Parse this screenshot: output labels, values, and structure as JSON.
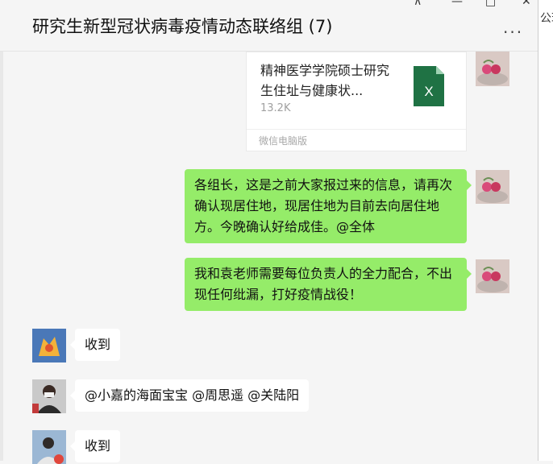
{
  "window": {
    "title": "研究生新型冠状病毒疫情动态联络组 (7)",
    "more_label": "...",
    "controls": {
      "pin": "⊼",
      "minimize": "—",
      "maximize": "□",
      "close": "✕"
    },
    "side_text": "公现"
  },
  "messages": [
    {
      "type": "file",
      "direction": "sent",
      "file_name": "精神医学学院硕士研究生住址与健康状...",
      "file_size": "13.2K",
      "source": "微信电脑版",
      "file_icon": "excel-file-icon",
      "file_icon_letter": "X",
      "file_icon_color": "#1f7244"
    },
    {
      "type": "text",
      "direction": "sent",
      "text": "各组长，这是之前大家报过来的信息，请再次确认现居住地，现居住地为目前去向居住地方。今晚确认好给成佳。@全体"
    },
    {
      "type": "text",
      "direction": "sent",
      "text": "我和袁老师需要每位负责人的全力配合，不出现任何纰漏，打好疫情战役！"
    },
    {
      "type": "text",
      "direction": "received",
      "text": "收到"
    },
    {
      "type": "text",
      "direction": "received",
      "text": "@小嘉的海面宝宝 @周思遥 @关陆阳"
    },
    {
      "type": "text",
      "direction": "received",
      "text": "收到"
    }
  ],
  "colors": {
    "sent_bubble": "#95ec69",
    "received_bubble": "#ffffff",
    "background": "#f5f5f5"
  }
}
